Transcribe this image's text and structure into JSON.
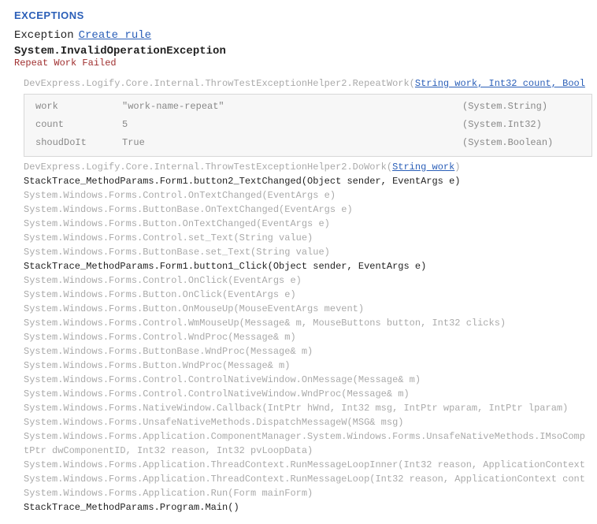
{
  "header": {
    "section_title": "EXCEPTIONS",
    "exception_label": "Exception",
    "create_rule_label": "Create rule",
    "exception_type": "System.InvalidOperationException",
    "exception_message": "Repeat Work Failed"
  },
  "frame1": {
    "prefix": "DevExpress.Logify.Core.Internal.ThrowTestExceptionHelper2.RepeatWork(",
    "link": "String work, Int32 count, Bool"
  },
  "params": [
    {
      "name": "work",
      "value": "\"work-name-repeat\"",
      "type": "(System.String)"
    },
    {
      "name": "count",
      "value": "5",
      "type": "(System.Int32)"
    },
    {
      "name": "shoudDoIt",
      "value": "True",
      "type": "(System.Boolean)"
    }
  ],
  "frame2": {
    "prefix": "DevExpress.Logify.Core.Internal.ThrowTestExceptionHelper2.DoWork(",
    "link": "String work",
    "suffix": ")"
  },
  "stack": [
    {
      "text": "StackTrace_MethodParams.Form1.button2_TextChanged(Object sender, EventArgs e)",
      "dark": true
    },
    {
      "text": "System.Windows.Forms.Control.OnTextChanged(EventArgs e)"
    },
    {
      "text": "System.Windows.Forms.ButtonBase.OnTextChanged(EventArgs e)"
    },
    {
      "text": "System.Windows.Forms.Button.OnTextChanged(EventArgs e)"
    },
    {
      "text": "System.Windows.Forms.Control.set_Text(String value)"
    },
    {
      "text": "System.Windows.Forms.ButtonBase.set_Text(String value)"
    },
    {
      "text": "StackTrace_MethodParams.Form1.button1_Click(Object sender, EventArgs e)",
      "dark": true
    },
    {
      "text": "System.Windows.Forms.Control.OnClick(EventArgs e)"
    },
    {
      "text": "System.Windows.Forms.Button.OnClick(EventArgs e)"
    },
    {
      "text": "System.Windows.Forms.Button.OnMouseUp(MouseEventArgs mevent)"
    },
    {
      "text": "System.Windows.Forms.Control.WmMouseUp(Message& m, MouseButtons button, Int32 clicks)"
    },
    {
      "text": "System.Windows.Forms.Control.WndProc(Message& m)"
    },
    {
      "text": "System.Windows.Forms.ButtonBase.WndProc(Message& m)"
    },
    {
      "text": "System.Windows.Forms.Button.WndProc(Message& m)"
    },
    {
      "text": "System.Windows.Forms.Control.ControlNativeWindow.OnMessage(Message& m)"
    },
    {
      "text": "System.Windows.Forms.Control.ControlNativeWindow.WndProc(Message& m)"
    },
    {
      "text": "System.Windows.Forms.NativeWindow.Callback(IntPtr hWnd, Int32 msg, IntPtr wparam, IntPtr lparam)"
    },
    {
      "text": "System.Windows.Forms.UnsafeNativeMethods.DispatchMessageW(MSG& msg)"
    },
    {
      "text": "System.Windows.Forms.Application.ComponentManager.System.Windows.Forms.UnsafeNativeMethods.IMsoComp"
    },
    {
      "text": "  tPtr dwComponentID, Int32 reason, Int32 pvLoopData)"
    },
    {
      "text": "System.Windows.Forms.Application.ThreadContext.RunMessageLoopInner(Int32 reason, ApplicationContext"
    },
    {
      "text": "System.Windows.Forms.Application.ThreadContext.RunMessageLoop(Int32 reason, ApplicationContext cont"
    },
    {
      "text": "System.Windows.Forms.Application.Run(Form mainForm)"
    },
    {
      "text": "StackTrace_MethodParams.Program.Main()",
      "dark": true
    }
  ]
}
